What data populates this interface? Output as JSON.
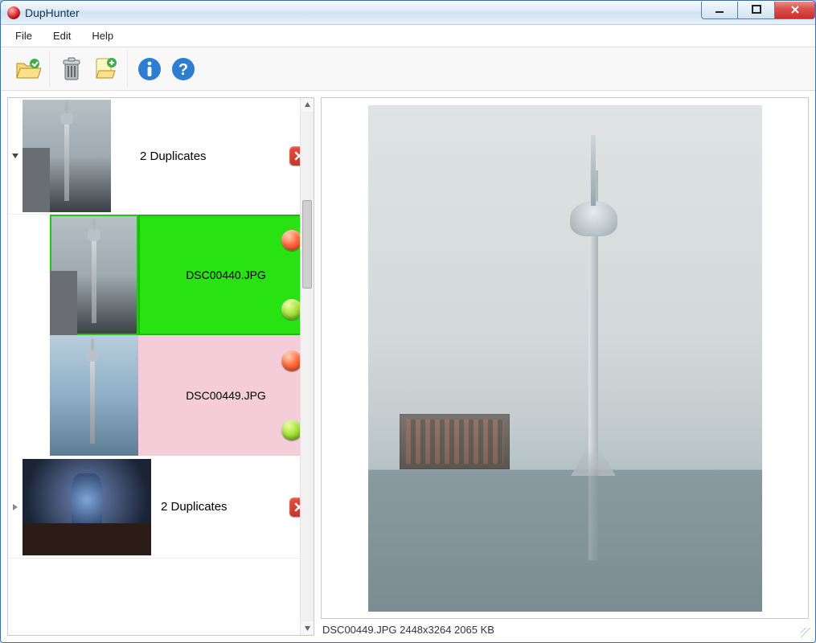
{
  "title": "DupHunter",
  "menu": {
    "file": "File",
    "edit": "Edit",
    "help": "Help"
  },
  "toolbar": {
    "open_folder": "Open folder",
    "delete": "Delete",
    "reveal": "Reveal in folder",
    "info": "Info",
    "help": "Help"
  },
  "groups": [
    {
      "label": "2 Duplicates",
      "expanded": true,
      "items": [
        {
          "filename": "DSC00440.JPG",
          "selected": true
        },
        {
          "filename": "DSC00449.JPG",
          "selected": false
        }
      ]
    },
    {
      "label": "2 Duplicates",
      "expanded": false
    }
  ],
  "preview": {
    "status": "DSC00449.JPG 2448x3264 2065 KB",
    "filename": "DSC00449.JPG",
    "dimensions": "2448x3264",
    "filesize": "2065 KB"
  }
}
